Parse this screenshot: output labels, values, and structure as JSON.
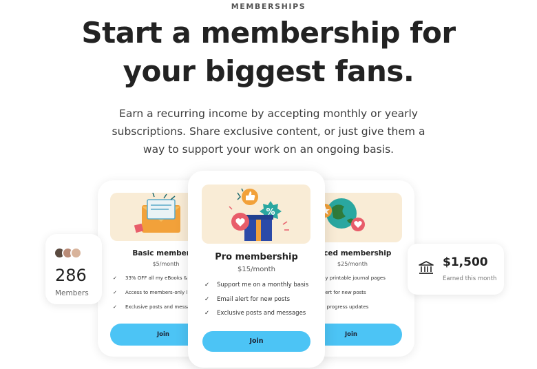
{
  "header": {
    "eyebrow": "MEMBERSHIPS",
    "headline_line1": "Start a membership for",
    "headline_line2": "your biggest fans.",
    "subtext_line1": "Earn a recurring income by accepting monthly or yearly",
    "subtext_line2": "subscriptions. Share exclusive content, or just give them a",
    "subtext_line3": "way to support your work on an ongoing basis."
  },
  "members_stat": {
    "count": "286",
    "label": "Members",
    "avatar_colors": [
      "#5a4a40",
      "#b98b77",
      "#d8b39b"
    ]
  },
  "earnings_stat": {
    "amount": "$1,500",
    "label": "Earned this month",
    "icon": "bank-icon"
  },
  "tiers": {
    "basic": {
      "title": "Basic membersh",
      "price": "$5/month",
      "features": [
        "33% OFF all my eBooks &",
        "Access to members-only l",
        "Exclusive posts and messa"
      ],
      "join_label": "Join"
    },
    "pro": {
      "title": "Pro membership",
      "price": "$15/month",
      "features": [
        "Support me on a monthly basis",
        "Email alert for new posts",
        "Exclusive posts and messages"
      ],
      "join_label": "Join"
    },
    "advanced": {
      "title": "anced membership",
      "price": "$25/month",
      "features": [
        "hly printable journal pages",
        "alert for new posts",
        "in progress updates"
      ],
      "join_label": "Join"
    }
  },
  "colors": {
    "accent": "#4cc4f5",
    "hero_bg": "#f9ecd6"
  }
}
